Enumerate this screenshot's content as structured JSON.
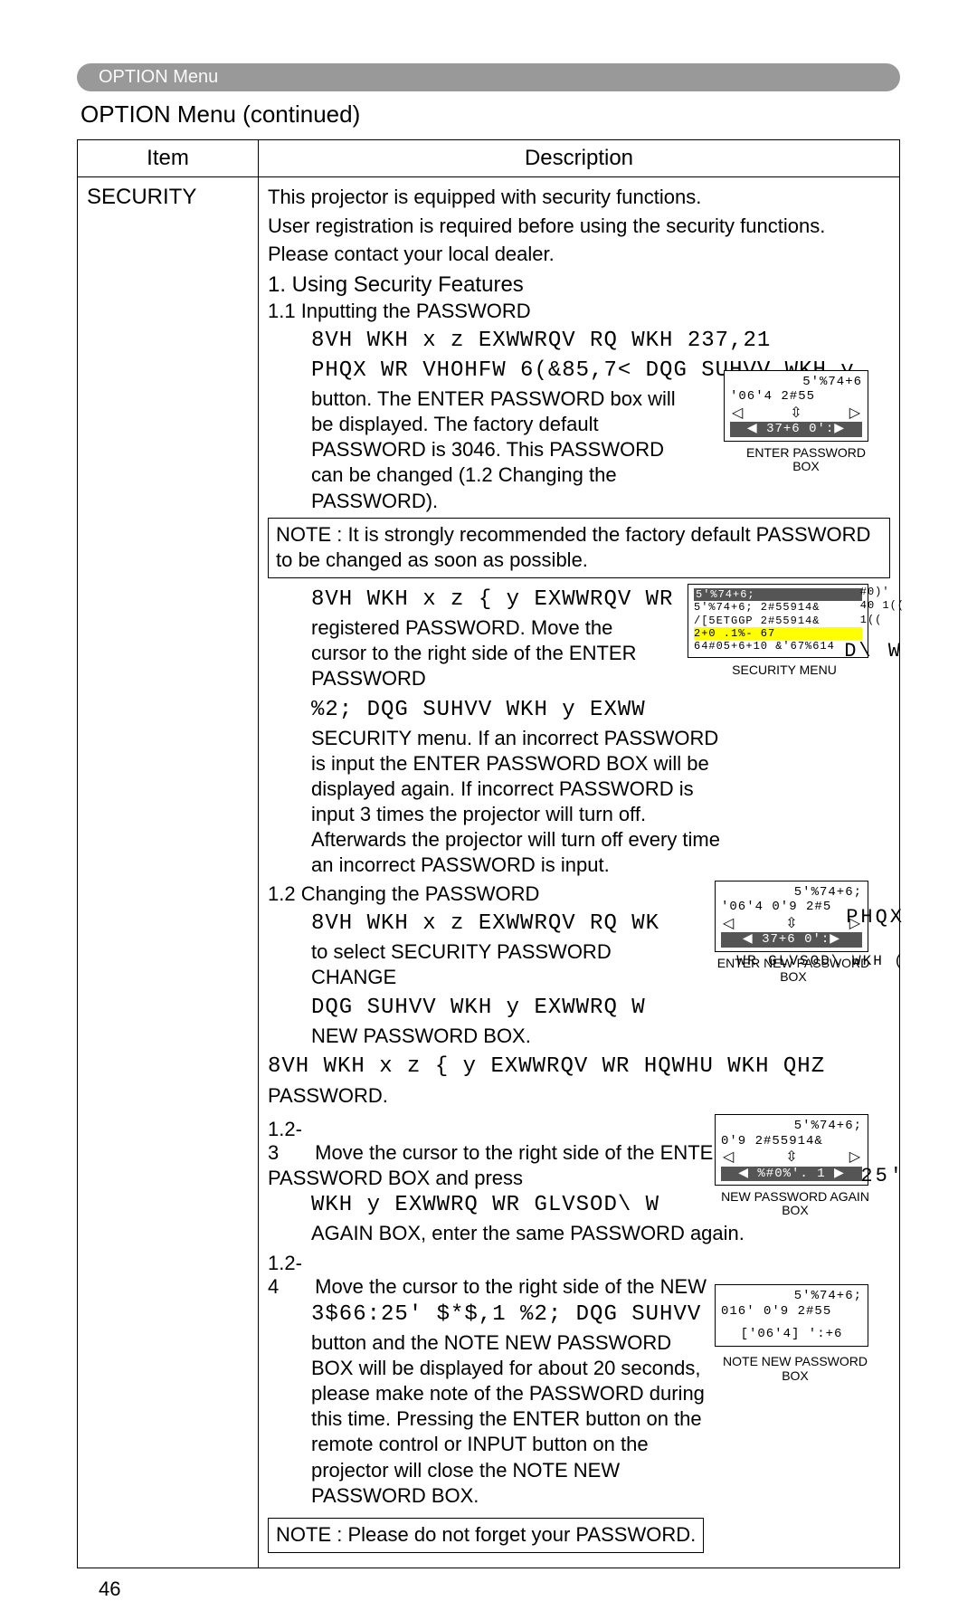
{
  "breadcrumb": "OPTION Menu",
  "section_title": "OPTION Menu (continued)",
  "table": {
    "headers": {
      "item": "Item",
      "desc": "Description"
    },
    "item_cell": "SECURITY"
  },
  "intro": {
    "l1": "This projector is equipped with security functions.",
    "l2": "User registration is required before using the security functions.",
    "l3": "Please contact your local dealer."
  },
  "sect1": {
    "heading": "1. Using Security Features",
    "sub11": "1.1 Inputting the PASSWORD",
    "garble1": "8VH WKH x z EXWWRQV RQ WKH 237,21",
    "garble2": "PHQX WR VHOHFW 6(&85,7< DQG SUHVV WKH y",
    "body1": "button. The ENTER PASSWORD box will be displayed. The factory default PASSWORD is 3046. This PASSWORD can be changed (1.2 Changing the PASSWORD).",
    "ui1_l1": "5'%74+6",
    "ui1_l2": "'06'4 2#55",
    "ui1_l3": "◀ 37+6     0':▶",
    "ui1_cap": "ENTER PASSWORD BOX",
    "note1": "NOTE : It is strongly recommended the factory default PASSWORD to be changed as soon as possible.",
    "garble3": "8VH WKH x z { y EXWWRQV WR",
    "body2": "registered PASSWORD. Move the cursor to the right side of the ENTER PASSWORD",
    "garble4": "%2; DQG SUHVV WKH y EXWW",
    "body2b": "SECURITY menu. If an incorrect PASSWORD is input the ENTER PASSWORD BOX will be displayed again. If incorrect PASSWORD is input 3 times the projector will turn off. Afterwards the projector will turn off every time an incorrect PASSWORD is input.",
    "ui2_l1": "5'%74+6;",
    "ui2_l2": "5'%74+6; 2#55914&",
    "ui2_l3": "/[5ETGGP 2#55914&",
    "ui2_l4": "2+0 .1%-        67",
    "ui2_l5": "64#05+6+10 &'67%614",
    "ui2_side1": "#0)'",
    "ui2_side2": "40 1((",
    "ui2_side3": "1((",
    "ui2_cap": "SECURITY MENU",
    "garble_tail": "D\\ W"
  },
  "sect12": {
    "heading": "1.2 Changing the PASSWORD",
    "garble1": "8VH WKH x z EXWWRQV RQ WK",
    "body1": "to select SECURITY PASSWORD CHANGE",
    "garble2": "DQG SUHVV WKH y EXWWRQ W",
    "body2": "NEW PASSWORD BOX.",
    "tail1": "PHQX",
    "ui_l1": "5'%74+6;",
    "ui_l2": "'06'4 0'9 2#5",
    "ui_l3": "◀ 37+6     0':▶",
    "ui_cap": "ENTER NEW PASSWORD BOX",
    "garble_tail": "WR GLVSOD\\ WKH ("
  },
  "step122": {
    "garble": "8VH WKH x z { y EXWWRQV WR HQWHU WKH QHZ",
    "body": "PASSWORD."
  },
  "step123": {
    "num": "1.2-3",
    "body1": "Move the cursor to the right side of the ENTER NEW PASSWORD BOX and press",
    "garble": "WKH y EXWWRQ WR GLVSOD\\ W",
    "body2": "AGAIN BOX, enter the same PASSWORD again.",
    "ui_l1": "5'%74+6;",
    "ui_l2": "0'9 2#55914&",
    "ui_l3": "◀ %#0%'.    1 ▶",
    "ui_cap": "NEW PASSWORD AGAIN BOX",
    "tail": "25'"
  },
  "step124": {
    "num": "1.2-4",
    "body1": "Move the cursor to the right side of the NEW",
    "garble": "3$66:25' $*$,1 %2; DQG SUHVV WKH y",
    "body2": "button and the NOTE NEW PASSWORD BOX will be displayed for about 20 seconds, please make note of the PASSWORD during this time. Pressing the ENTER button on the remote control or INPUT button on the projector will close the NOTE NEW PASSWORD BOX.",
    "ui_l1": "5'%74+6;",
    "ui_l2": "016' 0'9 2#55",
    "ui_l3": "['06'4]  ':+6",
    "ui_cap": "NOTE NEW PASSWORD BOX"
  },
  "note_end": "NOTE : Please do not forget your PASSWORD.",
  "page": "46"
}
